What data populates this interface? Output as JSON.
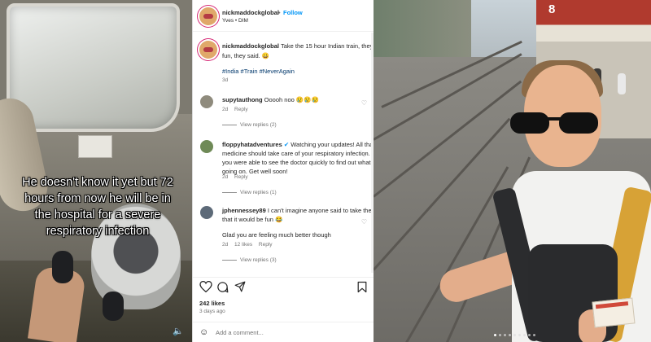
{
  "video": {
    "caption": "He doesn't know it yet but 72 hours from now he will be in the hospital for a severe respiratory infection"
  },
  "post": {
    "header": {
      "username": "nickmaddockglobal",
      "separator": "•",
      "follow_label": "Follow",
      "audio": "Yves • DIM"
    },
    "caption": {
      "username": "nickmaddockglobal",
      "text_line1": "Take the 15 hour Indian train, they s",
      "text_line2": "fun, they said. 😀",
      "hashtags": "#India #Train #NeverAgain",
      "time": "3d"
    },
    "comments": [
      {
        "username": "supytauthong",
        "lines": [
          "Ooooh noo 😢😢😢"
        ],
        "time": "2d",
        "likes": "",
        "reply_label": "Reply",
        "view_replies": "View replies (2)"
      },
      {
        "username": "floppyhatadventures",
        "lines": [
          "Watching your updates! All that",
          "medicine should take care of your respiratory infection. G",
          "you were able to see the doctor quickly to find out what",
          "going on. Get well soon!"
        ],
        "time": "2d",
        "likes": "",
        "reply_label": "Reply",
        "view_replies": "View replies (1)"
      },
      {
        "username": "jphennessey89",
        "lines": [
          "I can't imagine anyone said to take the tr",
          "that it would be fun 😂",
          "",
          "Glad you are feeling much better though"
        ],
        "time": "2d",
        "likes": "12 likes",
        "reply_label": "Reply",
        "view_replies": "View replies (3)"
      }
    ],
    "actions": {
      "like_icon": "heart-icon",
      "comment_icon": "comment-icon",
      "share_icon": "share-icon"
    },
    "likes": "242 likes",
    "date": "3 days ago",
    "add_comment_placeholder": "Add a comment..."
  },
  "photo": {
    "platform_number": "8",
    "carousel_dots": 9,
    "carousel_active": 0
  },
  "colors": {
    "follow_blue": "#0095f6",
    "hashtag_blue": "#00376b",
    "avatar_ring": "#d62976"
  }
}
